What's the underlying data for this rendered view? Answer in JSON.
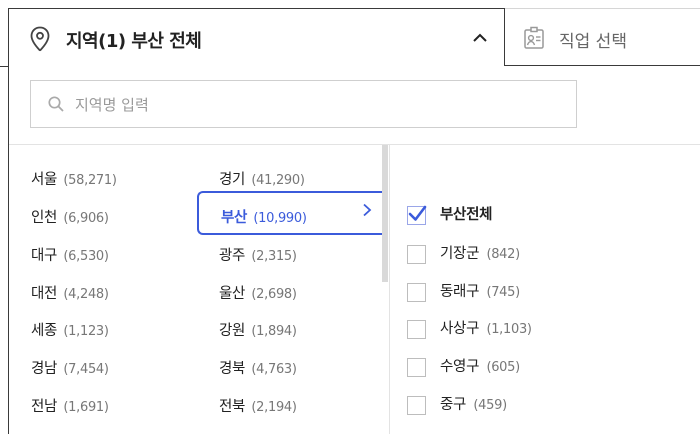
{
  "tabs": {
    "region_label": "지역(1) 부산 전체",
    "job_label": "직업 선택"
  },
  "search": {
    "placeholder": "지역명 입력",
    "value": ""
  },
  "regions_col1": [
    {
      "name": "서울",
      "count": "(58,271)"
    },
    {
      "name": "인천",
      "count": "(6,906)"
    },
    {
      "name": "대구",
      "count": "(6,530)"
    },
    {
      "name": "대전",
      "count": "(4,248)"
    },
    {
      "name": "세종",
      "count": "(1,123)"
    },
    {
      "name": "경남",
      "count": "(7,454)"
    },
    {
      "name": "전남",
      "count": "(1,691)"
    }
  ],
  "regions_col2": [
    {
      "name": "경기",
      "count": "(41,290)"
    },
    {
      "name": "부산",
      "count": "(10,990)",
      "selected": true
    },
    {
      "name": "광주",
      "count": "(2,315)"
    },
    {
      "name": "울산",
      "count": "(2,698)"
    },
    {
      "name": "강원",
      "count": "(1,894)"
    },
    {
      "name": "경북",
      "count": "(4,763)"
    },
    {
      "name": "전북",
      "count": "(2,194)"
    }
  ],
  "districts": [
    {
      "name": "부산전체",
      "count": "",
      "checked": true
    },
    {
      "name": "기장군",
      "count": "(842)",
      "checked": false
    },
    {
      "name": "동래구",
      "count": "(745)",
      "checked": false
    },
    {
      "name": "사상구",
      "count": "(1,103)",
      "checked": false
    },
    {
      "name": "수영구",
      "count": "(605)",
      "checked": false
    },
    {
      "name": "중구",
      "count": "(459)",
      "checked": false
    }
  ],
  "colors": {
    "accent": "#3b5bdb",
    "border": "#3a3a3a"
  }
}
